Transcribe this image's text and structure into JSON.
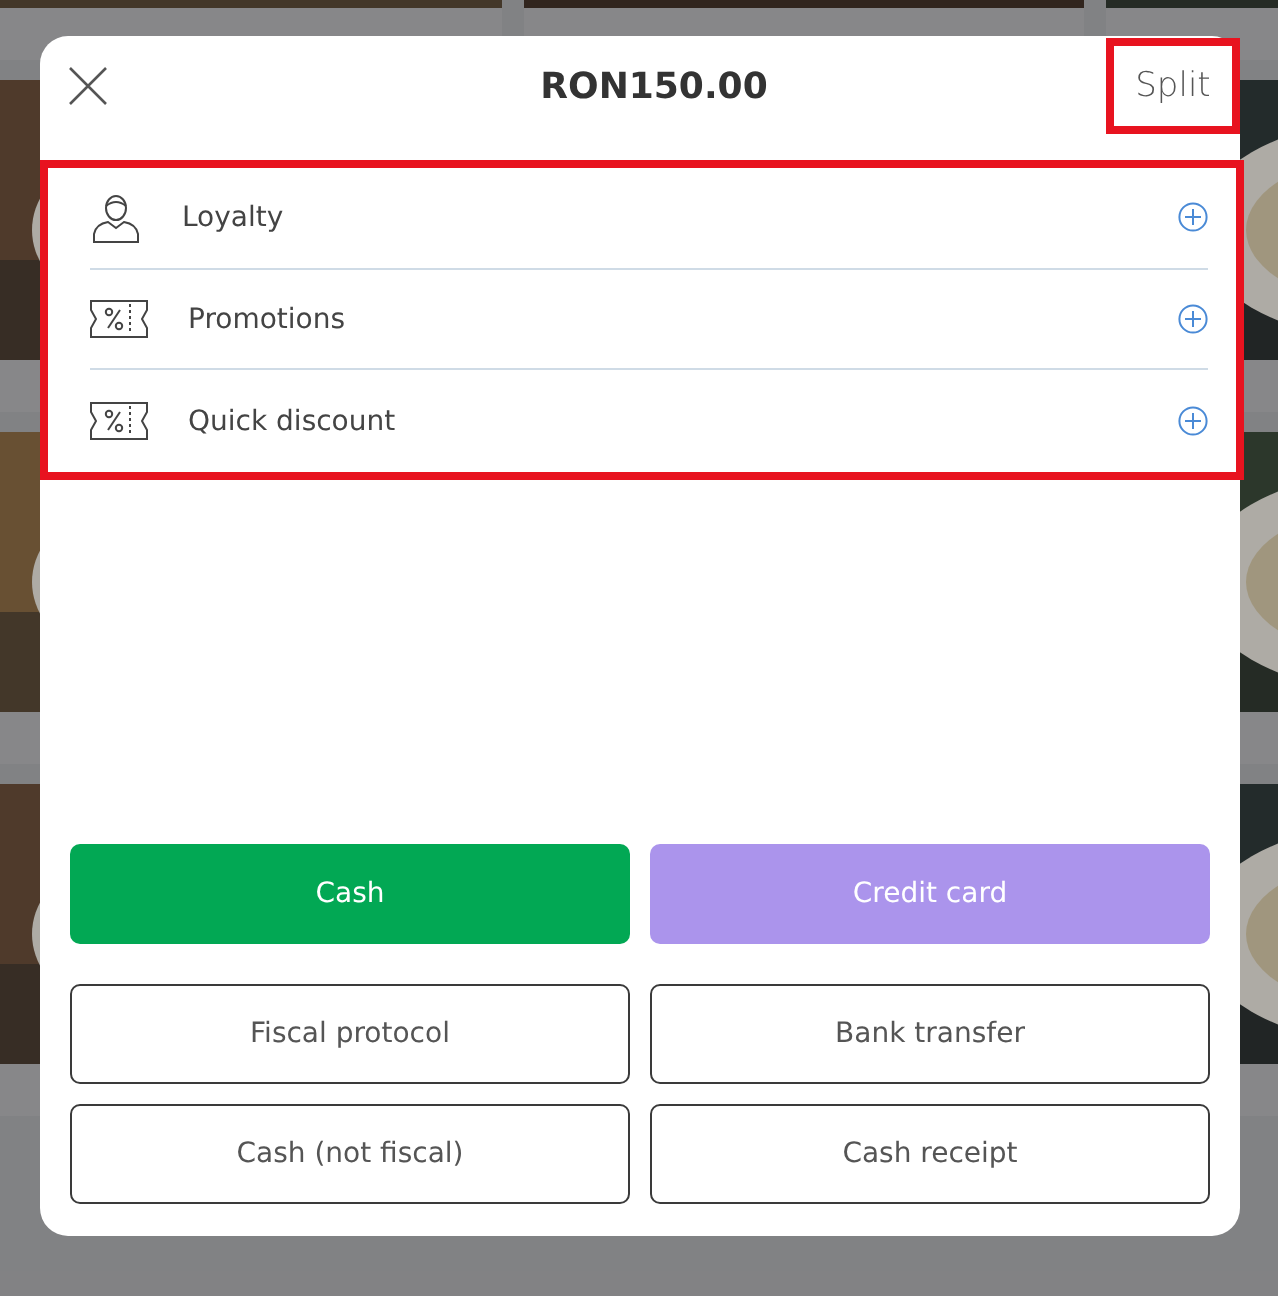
{
  "dialog": {
    "title": "RON150.00",
    "split_button": {
      "label": "Split",
      "highlighted": true
    },
    "discounts": {
      "highlighted": true,
      "items": [
        {
          "label": "Loyalty",
          "kind": "person"
        },
        {
          "label": "Promotions",
          "kind": "coupon"
        },
        {
          "label": "Quick discount",
          "kind": "coupon"
        }
      ]
    },
    "payment_buttons": [
      {
        "label": "Cash",
        "kind": "primary",
        "color": "#02a854"
      },
      {
        "label": "Credit card",
        "kind": "primary",
        "color": "#ab94ec"
      },
      {
        "label": "Fiscal protocol",
        "kind": "outline"
      },
      {
        "label": "Bank transfer",
        "kind": "outline"
      },
      {
        "label": "Cash (not fiscal)",
        "kind": "outline"
      },
      {
        "label": "Cash receipt",
        "kind": "outline"
      }
    ]
  }
}
